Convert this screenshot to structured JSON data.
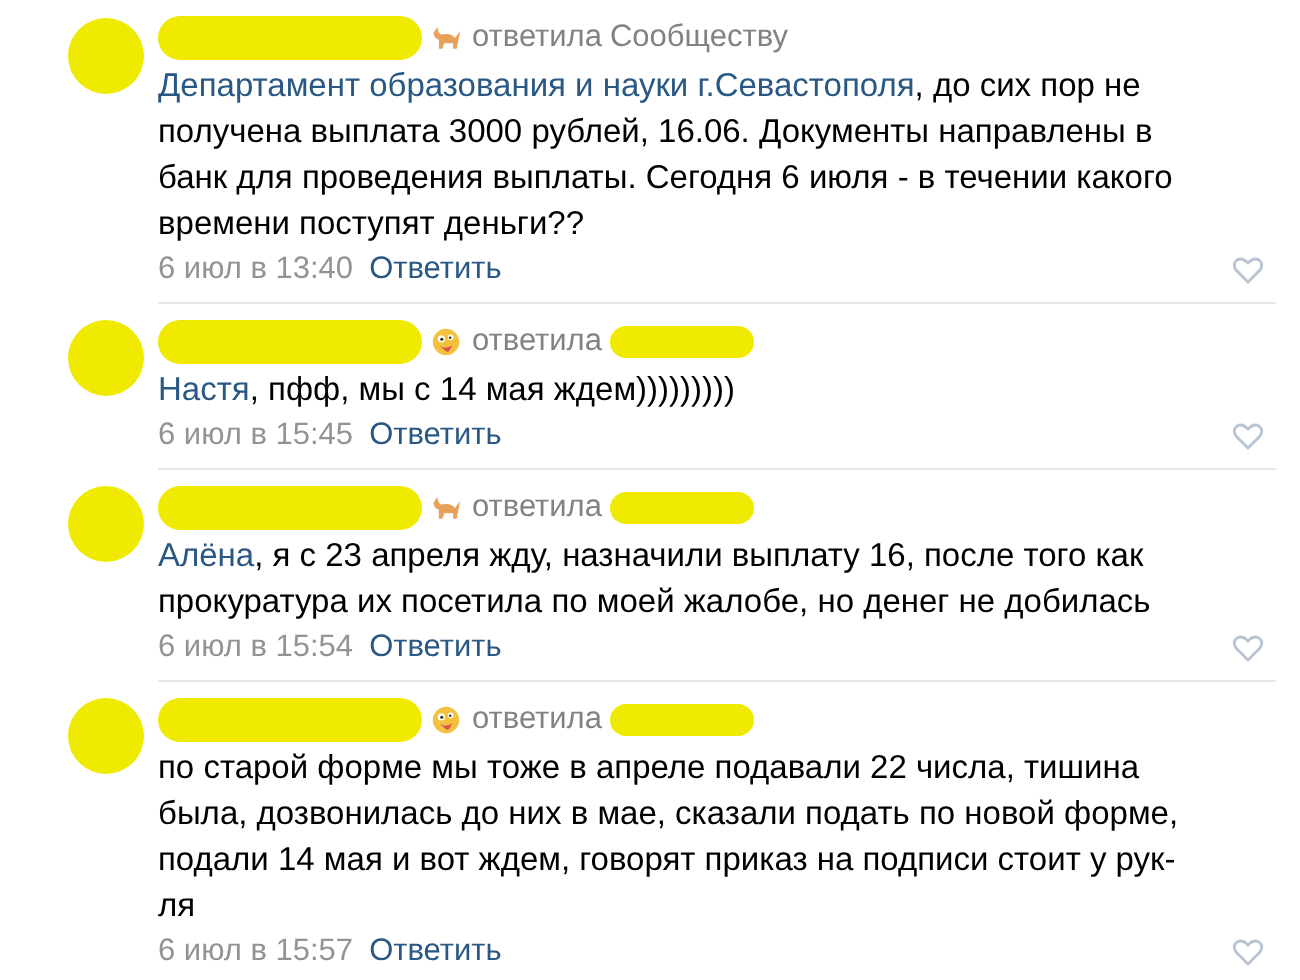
{
  "comments": [
    {
      "kind": "cat",
      "verb": "ответила",
      "recipient": "Сообществу",
      "recipient_redacted": false,
      "mention": "Департамент образования и науки г.Севастополя",
      "text": ", до сих пор не\nполучена выплата 3000 рублей, 16.06. Документы направлены в\nбанк для проведения выплаты. Сегодня 6 июля - в течении какого\nвремени поступят деньги??",
      "date": "6 июл в 13:40",
      "reply": "Ответить"
    },
    {
      "kind": "emoji",
      "verb": "ответила",
      "recipient_redacted": true,
      "mention": "Настя",
      "text": ", пфф, мы с 14 мая ждем)))))))))",
      "date": "6 июл в 15:45",
      "reply": "Ответить"
    },
    {
      "kind": "cat",
      "verb": "ответила",
      "recipient_redacted": true,
      "mention": "Алёна",
      "text": ", я с 23 апреля жду, назначили выплату 16, после того как\nпрокуратура их посетила по моей жалобе, но денег не добилась",
      "date": "6 июл в 15:54",
      "reply": "Ответить"
    },
    {
      "kind": "emoji",
      "verb": "ответила",
      "recipient_redacted": true,
      "text": "по старой форме мы тоже в апреле подавали 22 числа, тишина\nбыла, дозвонилась до них в мае, сказали подать по новой форме,\nподали 14 мая и вот ждем, говорят приказ на подписи стоит у рук-\nля",
      "date": "6 июл в 15:57",
      "reply": "Ответить"
    }
  ]
}
